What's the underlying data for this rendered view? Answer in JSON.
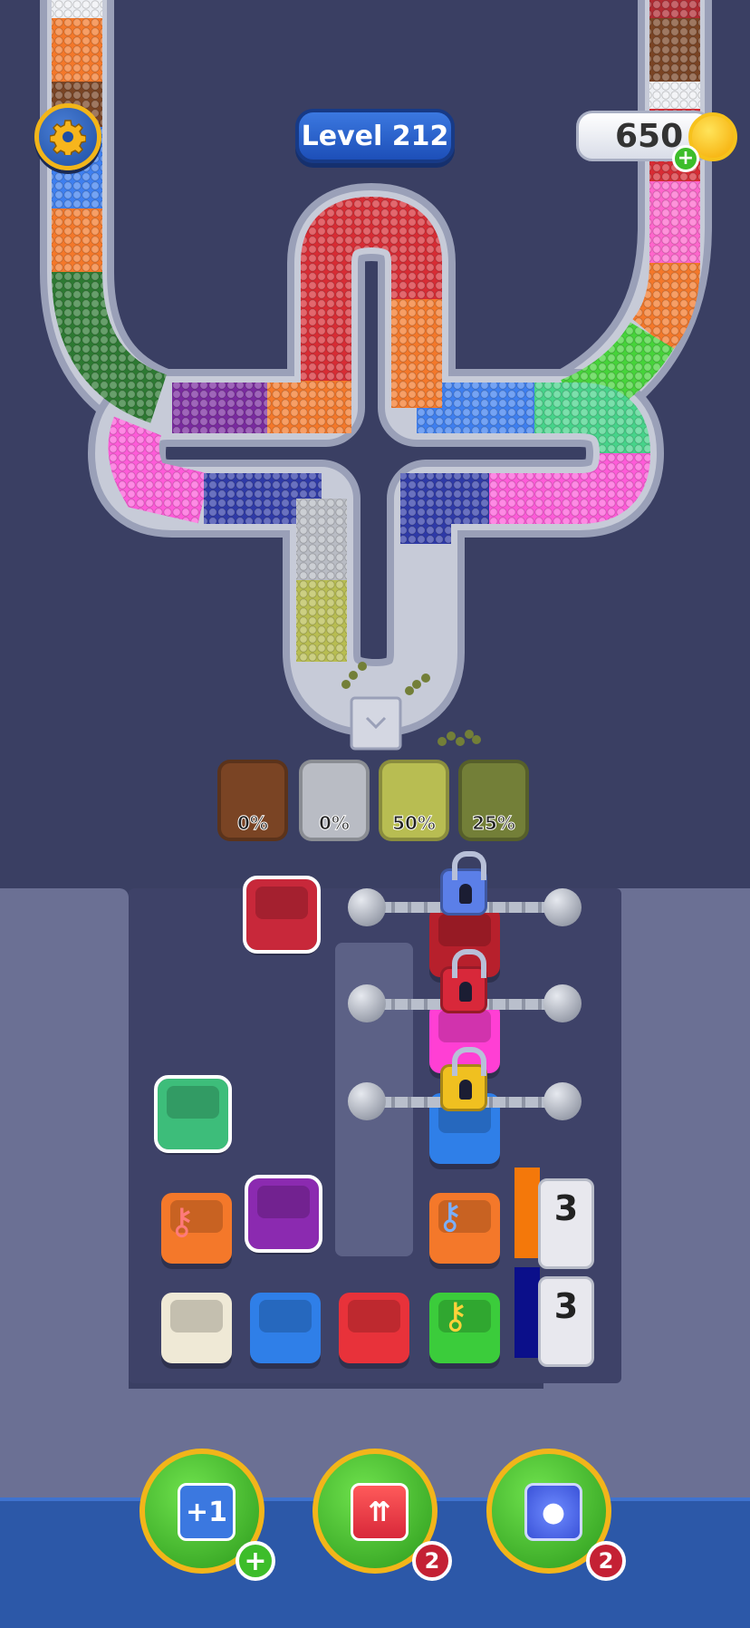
{
  "hud": {
    "level_label": "Level 212",
    "coins": "650",
    "coin_plus": "+"
  },
  "collectors": [
    {
      "color": "#7a4424",
      "percent": "0%"
    },
    {
      "color": "#b9bcc4",
      "percent": "0%"
    },
    {
      "color": "#b8bd52",
      "percent": "50%"
    },
    {
      "color": "#737f38",
      "percent": "25%"
    }
  ],
  "track_colors": {
    "left_arm": [
      "#eef0f4",
      "#f4782a",
      "#7a4424",
      "#3e7ff0",
      "#f4782a",
      "#2d7a32"
    ],
    "right_arm": [
      "#b22a32",
      "#7a4424",
      "#eef0f4",
      "#d82c34",
      "#ff66cc",
      "#f4782a",
      "#46d43a"
    ],
    "loop": [
      "#7a2aa0",
      "#f4782a",
      "#ff5bd9",
      "#d82c34",
      "#2f3aa8",
      "#b9bcc4",
      "#b8bd52",
      "#3e7ff0",
      "#46d48a",
      "#ff5bd9",
      "#2f3aa8"
    ]
  },
  "board": {
    "boxes": [
      {
        "name": "red-box-selected",
        "color": "#c8283a",
        "selected": true
      },
      {
        "name": "green-box-selected",
        "color": "#3dbd7a",
        "selected": true
      },
      {
        "name": "orange-key-box",
        "color": "#f4782a",
        "key": "pink"
      },
      {
        "name": "purple-box-selected",
        "color": "#8b2ab0",
        "selected": true
      },
      {
        "name": "cream-box",
        "color": "#efe9d6"
      },
      {
        "name": "blue-box",
        "color": "#2f7fe8"
      },
      {
        "name": "red-box",
        "color": "#e8323a"
      },
      {
        "name": "green-key-box",
        "color": "#3bcc3b",
        "key": "yellow"
      },
      {
        "name": "orange-key-box-right",
        "color": "#f4782a",
        "key": "blue"
      },
      {
        "name": "locked-red-box",
        "color": "#b7202c"
      },
      {
        "name": "locked-pink-box",
        "color": "#ff3fd4"
      },
      {
        "name": "locked-blue-box",
        "color": "#2f7fe8"
      }
    ],
    "locks": [
      {
        "color": "#5b7fe8"
      },
      {
        "color": "#d8283a"
      },
      {
        "color": "#f0c020"
      }
    ],
    "counters": [
      {
        "color": "#f4780a",
        "value": "3"
      },
      {
        "color": "#0b0f8a",
        "value": "3"
      }
    ]
  },
  "boosters": [
    {
      "name": "add-slot",
      "icon_text": "+1",
      "badge": "+"
    },
    {
      "name": "lift-box",
      "icon_text": "",
      "badge": "2"
    },
    {
      "name": "shuffle-balls",
      "icon_text": "",
      "badge": "2"
    }
  ]
}
